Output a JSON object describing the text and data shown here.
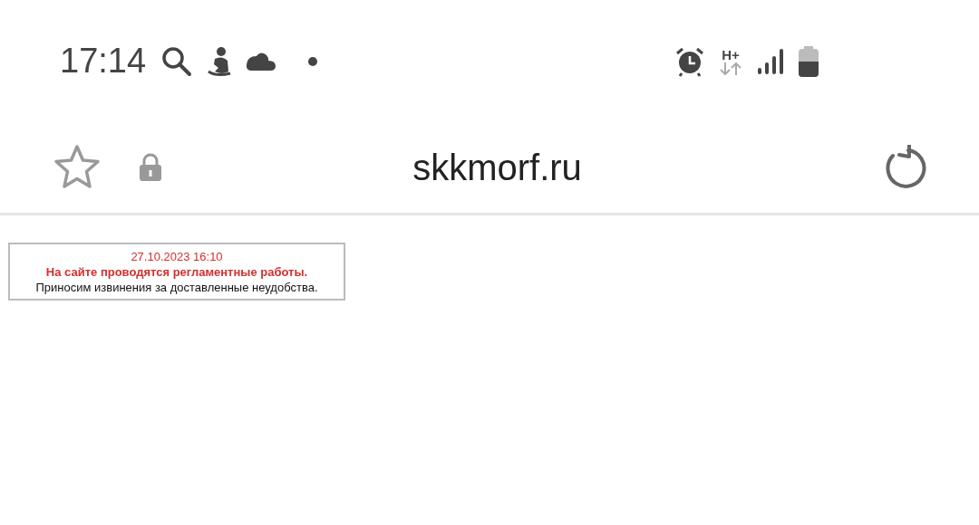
{
  "status_bar": {
    "time": "17:14",
    "network": "H+"
  },
  "address_bar": {
    "url": "skkmorf.ru"
  },
  "notice": {
    "lines": [
      {
        "kind": "date",
        "text": "27.10.2023 16:10"
      },
      {
        "kind": "warning",
        "text": "На сайте проводятся регламентные работы."
      },
      {
        "kind": "normal",
        "text": "Приносим извинения за доставленные неудобства."
      }
    ]
  }
}
